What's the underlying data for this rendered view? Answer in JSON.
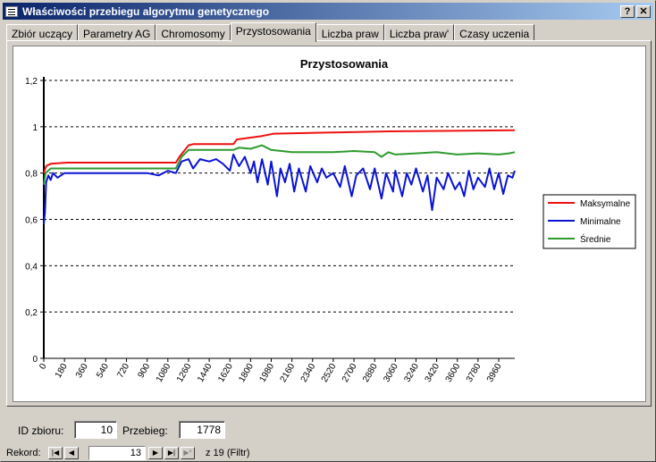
{
  "window": {
    "title": "Właściwości przebiegu algorytmu genetycznego",
    "help_button": "?",
    "close_button": "✕"
  },
  "tabs": [
    {
      "label": "Zbiór uczący",
      "active": false
    },
    {
      "label": "Parametry AG",
      "active": false
    },
    {
      "label": "Chromosomy",
      "active": false
    },
    {
      "label": "Przystosowania",
      "active": true
    },
    {
      "label": "Liczba praw",
      "active": false
    },
    {
      "label": "Liczba praw'",
      "active": false
    },
    {
      "label": "Czasy uczenia",
      "active": false
    }
  ],
  "form": {
    "id_label": "ID zbioru:",
    "id_value": "10",
    "run_label": "Przebieg:",
    "run_value": "1778"
  },
  "navigator": {
    "label": "Rekord:",
    "current": "13",
    "total_text": "z  19 (Filtr)"
  },
  "chart_data": {
    "type": "line",
    "title": "Przystosowania",
    "ylim": [
      0,
      1.2
    ],
    "xlim": [
      0,
      4100
    ],
    "yticks": [
      "0",
      "0,2",
      "0,4",
      "0,6",
      "0,8",
      "1",
      "1,2"
    ],
    "xticks": [
      "0",
      "180",
      "360",
      "540",
      "720",
      "900",
      "1080",
      "1260",
      "1440",
      "1620",
      "1800",
      "1980",
      "2160",
      "2340",
      "2520",
      "2700",
      "2880",
      "3060",
      "3240",
      "3420",
      "3600",
      "3780",
      "3960"
    ],
    "grid": "horizontal dashed",
    "legend_position": "right",
    "series": [
      {
        "name": "Maksymalne",
        "color": "#ee1111",
        "points": [
          [
            0,
            0.8
          ],
          [
            20,
            0.83
          ],
          [
            60,
            0.84
          ],
          [
            200,
            0.845
          ],
          [
            1150,
            0.845
          ],
          [
            1180,
            0.87
          ],
          [
            1260,
            0.92
          ],
          [
            1300,
            0.925
          ],
          [
            1650,
            0.925
          ],
          [
            1680,
            0.945
          ],
          [
            1900,
            0.96
          ],
          [
            2000,
            0.97
          ],
          [
            2500,
            0.975
          ],
          [
            3000,
            0.98
          ],
          [
            4100,
            0.985
          ]
        ]
      },
      {
        "name": "Średnie",
        "color": "#2e9a2e",
        "points": [
          [
            0,
            0.75
          ],
          [
            15,
            0.8
          ],
          [
            60,
            0.82
          ],
          [
            1150,
            0.82
          ],
          [
            1200,
            0.87
          ],
          [
            1260,
            0.9
          ],
          [
            1650,
            0.9
          ],
          [
            1700,
            0.91
          ],
          [
            1800,
            0.905
          ],
          [
            1900,
            0.92
          ],
          [
            1980,
            0.9
          ],
          [
            2160,
            0.89
          ],
          [
            2340,
            0.89
          ],
          [
            2520,
            0.89
          ],
          [
            2700,
            0.895
          ],
          [
            2880,
            0.89
          ],
          [
            2940,
            0.87
          ],
          [
            3000,
            0.89
          ],
          [
            3060,
            0.88
          ],
          [
            3240,
            0.885
          ],
          [
            3420,
            0.89
          ],
          [
            3600,
            0.88
          ],
          [
            3780,
            0.885
          ],
          [
            3960,
            0.88
          ],
          [
            4050,
            0.885
          ],
          [
            4100,
            0.89
          ]
        ]
      },
      {
        "name": "Minimalne",
        "color": "#0a14d2",
        "points": [
          [
            0,
            0.58
          ],
          [
            10,
            0.63
          ],
          [
            20,
            0.76
          ],
          [
            40,
            0.79
          ],
          [
            60,
            0.77
          ],
          [
            80,
            0.8
          ],
          [
            120,
            0.78
          ],
          [
            180,
            0.8
          ],
          [
            360,
            0.8
          ],
          [
            540,
            0.8
          ],
          [
            720,
            0.8
          ],
          [
            900,
            0.8
          ],
          [
            1000,
            0.79
          ],
          [
            1080,
            0.81
          ],
          [
            1150,
            0.8
          ],
          [
            1200,
            0.85
          ],
          [
            1260,
            0.86
          ],
          [
            1300,
            0.82
          ],
          [
            1360,
            0.86
          ],
          [
            1440,
            0.85
          ],
          [
            1500,
            0.86
          ],
          [
            1560,
            0.84
          ],
          [
            1620,
            0.81
          ],
          [
            1650,
            0.88
          ],
          [
            1700,
            0.83
          ],
          [
            1750,
            0.87
          ],
          [
            1800,
            0.8
          ],
          [
            1830,
            0.85
          ],
          [
            1860,
            0.76
          ],
          [
            1900,
            0.86
          ],
          [
            1950,
            0.75
          ],
          [
            1980,
            0.85
          ],
          [
            2030,
            0.7
          ],
          [
            2060,
            0.82
          ],
          [
            2100,
            0.76
          ],
          [
            2140,
            0.84
          ],
          [
            2180,
            0.72
          ],
          [
            2220,
            0.82
          ],
          [
            2280,
            0.72
          ],
          [
            2320,
            0.83
          ],
          [
            2380,
            0.76
          ],
          [
            2420,
            0.82
          ],
          [
            2460,
            0.78
          ],
          [
            2520,
            0.8
          ],
          [
            2580,
            0.74
          ],
          [
            2620,
            0.83
          ],
          [
            2680,
            0.7
          ],
          [
            2720,
            0.79
          ],
          [
            2780,
            0.82
          ],
          [
            2840,
            0.73
          ],
          [
            2880,
            0.82
          ],
          [
            2940,
            0.69
          ],
          [
            2980,
            0.8
          ],
          [
            3040,
            0.72
          ],
          [
            3060,
            0.81
          ],
          [
            3120,
            0.7
          ],
          [
            3160,
            0.8
          ],
          [
            3200,
            0.75
          ],
          [
            3240,
            0.82
          ],
          [
            3300,
            0.72
          ],
          [
            3340,
            0.79
          ],
          [
            3380,
            0.64
          ],
          [
            3420,
            0.78
          ],
          [
            3480,
            0.73
          ],
          [
            3520,
            0.8
          ],
          [
            3580,
            0.73
          ],
          [
            3620,
            0.76
          ],
          [
            3660,
            0.7
          ],
          [
            3700,
            0.81
          ],
          [
            3740,
            0.73
          ],
          [
            3780,
            0.78
          ],
          [
            3840,
            0.74
          ],
          [
            3880,
            0.82
          ],
          [
            3920,
            0.73
          ],
          [
            3960,
            0.8
          ],
          [
            4000,
            0.71
          ],
          [
            4040,
            0.79
          ],
          [
            4080,
            0.78
          ],
          [
            4100,
            0.81
          ]
        ]
      }
    ]
  }
}
